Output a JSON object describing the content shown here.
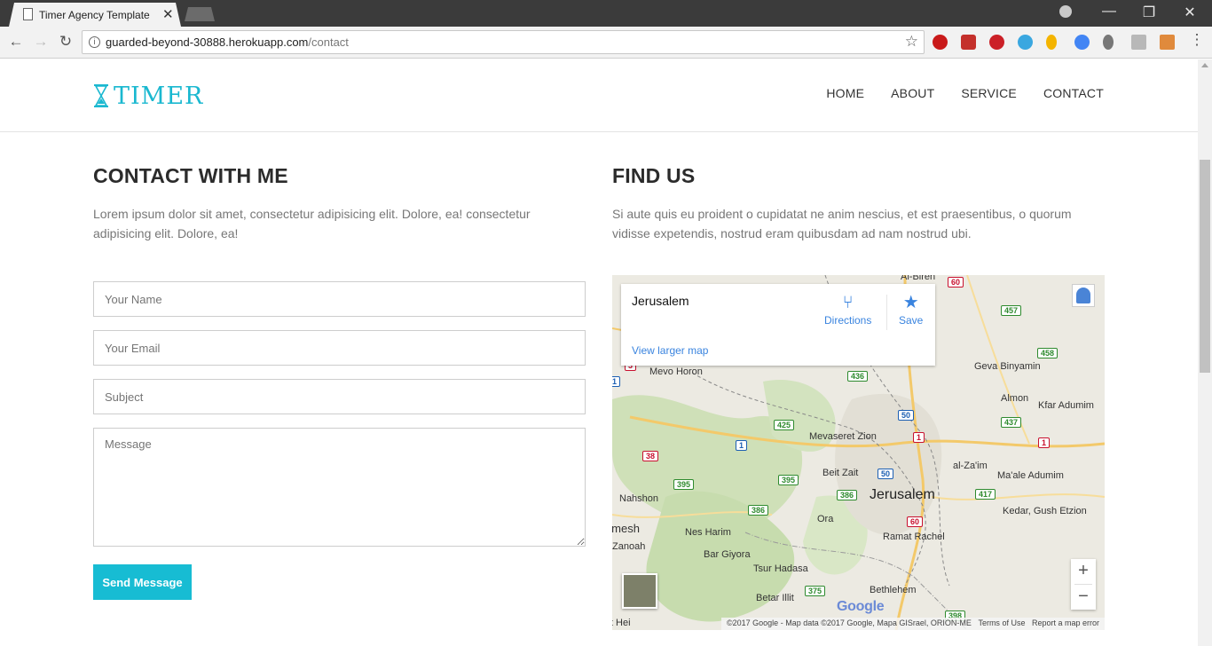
{
  "browser": {
    "tab_title": "Timer Agency Template",
    "tab_close": "✕",
    "url_host": "guarded-beyond-30888.herokuapp.com",
    "url_path": "/contact",
    "window_controls": {
      "minimize": "—",
      "restore": "❐",
      "close": "✕"
    }
  },
  "header": {
    "logo_text": "TIMER",
    "nav": [
      "HOME",
      "ABOUT",
      "SERVICE",
      "CONTACT"
    ]
  },
  "contact": {
    "title": "CONTACT WITH ME",
    "description": "Lorem ipsum dolor sit amet, consectetur adipisicing elit. Dolore, ea! consectetur adipisicing elit. Dolore, ea!",
    "name_placeholder": "Your Name",
    "email_placeholder": "Your Email",
    "subject_placeholder": "Subject",
    "message_placeholder": "Message",
    "send_label": "Send Message"
  },
  "find_us": {
    "title": "FIND US",
    "description": "Si aute quis eu proident o cupidatat ne anim nescius, et est praesentibus, o quorum vidisse expetendis, nostrud eram quibusdam ad nam nostrud ubi."
  },
  "map": {
    "place_name": "Jerusalem",
    "directions_label": "Directions",
    "save_label": "Save",
    "view_larger": "View larger map",
    "zoom_in": "+",
    "zoom_out": "−",
    "google": "Google",
    "attribution": "©2017 Google - Map data ©2017 Google, Mapa GISrael, ORION-ME",
    "terms": "Terms of Use",
    "report": "Report a map error",
    "labels": [
      {
        "text": "Al-Bireh"
      },
      {
        "text": "Geva Binyamin"
      },
      {
        "text": "Almon"
      },
      {
        "text": "Kfar Adumim"
      },
      {
        "text": "Mevo Horon"
      },
      {
        "text": "Mevaseret Zion"
      },
      {
        "text": "Beit Zait"
      },
      {
        "text": "Jerusalem"
      },
      {
        "text": "Ma'ale Adumim"
      },
      {
        "text": "Nahshon"
      },
      {
        "text": "Ora"
      },
      {
        "text": "Nes Harim"
      },
      {
        "text": "Kedar, Gush Etzion"
      },
      {
        "text": "Beit Shemesh"
      },
      {
        "text": "Ramat Rachel"
      },
      {
        "text": "Zanoah"
      },
      {
        "text": "Bar Giyora"
      },
      {
        "text": "Tsur Hadasa"
      },
      {
        "text": "Betar Illit"
      },
      {
        "text": "Bethlehem"
      },
      {
        "text": "Beit Hei"
      },
      {
        "text": "al-Za'im"
      }
    ],
    "shields": [
      "60",
      "457",
      "458",
      "436",
      "50",
      "437",
      "425",
      "1",
      "1",
      "1",
      "38",
      "50",
      "395",
      "395",
      "386",
      "386",
      "417",
      "60",
      "375",
      "398",
      "3",
      "1"
    ]
  }
}
